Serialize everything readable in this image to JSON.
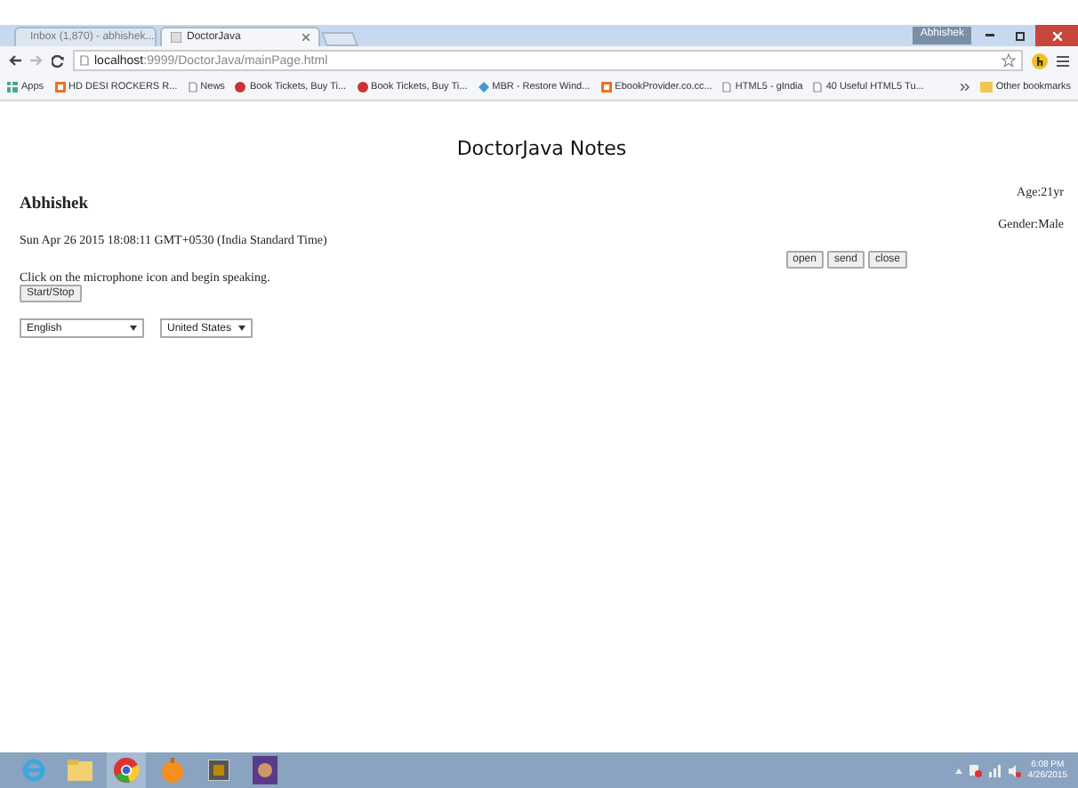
{
  "browser": {
    "tabs": [
      {
        "label": "Inbox (1,870) - abhishek...",
        "selected": false
      },
      {
        "label": "DoctorJava",
        "selected": true
      }
    ],
    "profile": "Abhishek",
    "address": {
      "host": "localhost",
      "path": ":9999/DoctorJava/mainPage.html"
    },
    "bookmarks": [
      {
        "label": "Apps",
        "kind": "apps"
      },
      {
        "label": "HD DESI ROCKERS R...",
        "kind": "site"
      },
      {
        "label": "News",
        "kind": "page"
      },
      {
        "label": "Book Tickets, Buy Ti...",
        "kind": "tickets"
      },
      {
        "label": "Book Tickets, Buy Ti...",
        "kind": "tickets"
      },
      {
        "label": "MBR - Restore Wind...",
        "kind": "diamond"
      },
      {
        "label": "EbookProvider.co.cc...",
        "kind": "site"
      },
      {
        "label": "HTML5 - gIndia",
        "kind": "page"
      },
      {
        "label": "40 Useful HTML5 Tu...",
        "kind": "page"
      }
    ],
    "other_bookmarks": "Other bookmarks"
  },
  "page": {
    "title": "DoctorJava Notes",
    "name": "Abhishek",
    "age": "Age:21yr",
    "gender": "Gender:Male",
    "date": "Sun Apr 26 2015 18:08:11 GMT+0530 (India Standard Time)",
    "actions": [
      "open",
      "send",
      "close"
    ],
    "instruction": "Click on the microphone icon and begin speaking.",
    "start_stop": "Start/Stop",
    "language": "English",
    "dialect": "United States"
  },
  "taskbar": {
    "apps": [
      {
        "kind": "ie",
        "selected": false
      },
      {
        "kind": "folder",
        "selected": false
      },
      {
        "kind": "chrome",
        "selected": true
      },
      {
        "kind": "orb",
        "selected": false
      },
      {
        "kind": "app",
        "selected": false
      },
      {
        "kind": "emblem",
        "selected": false
      }
    ],
    "time": "6:08 PM",
    "date": "4/26/2015"
  }
}
